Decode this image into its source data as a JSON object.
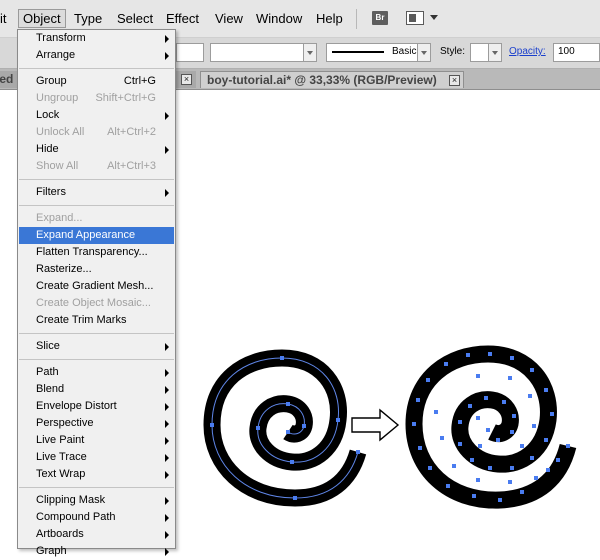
{
  "menubar": {
    "items": [
      "it",
      "Object",
      "Type",
      "Select",
      "Effect",
      "View",
      "Window",
      "Help"
    ],
    "active": "Object",
    "bridge_label": "Br"
  },
  "controlbar": {
    "stroke_style": "Basic",
    "style_label": "Style:",
    "opacity_label": "Opacity:",
    "opacity_value": "100"
  },
  "tabs": {
    "left_tab_label": "led",
    "active_tab_label": "boy-tutorial.ai* @ 33,33% (RGB/Preview)",
    "close_glyph": "×"
  },
  "menu": {
    "groups": [
      [
        {
          "label": "Transform",
          "submenu": true
        },
        {
          "label": "Arrange",
          "submenu": true
        }
      ],
      [
        {
          "label": "Group",
          "shortcut": "Ctrl+G"
        },
        {
          "label": "Ungroup",
          "shortcut": "Shift+Ctrl+G",
          "disabled": true
        },
        {
          "label": "Lock",
          "submenu": true
        },
        {
          "label": "Unlock All",
          "shortcut": "Alt+Ctrl+2",
          "disabled": true
        },
        {
          "label": "Hide",
          "submenu": true
        },
        {
          "label": "Show All",
          "shortcut": "Alt+Ctrl+3",
          "disabled": true
        }
      ],
      [
        {
          "label": "Filters",
          "submenu": true
        }
      ],
      [
        {
          "label": "Expand...",
          "disabled": true
        },
        {
          "label": "Expand Appearance",
          "highlight": true
        },
        {
          "label": "Flatten Transparency..."
        },
        {
          "label": "Rasterize..."
        },
        {
          "label": "Create Gradient Mesh..."
        },
        {
          "label": "Create Object Mosaic...",
          "disabled": true
        },
        {
          "label": "Create Trim Marks"
        }
      ],
      [
        {
          "label": "Slice",
          "submenu": true
        }
      ],
      [
        {
          "label": "Path",
          "submenu": true
        },
        {
          "label": "Blend",
          "submenu": true
        },
        {
          "label": "Envelope Distort",
          "submenu": true
        },
        {
          "label": "Perspective",
          "submenu": true
        },
        {
          "label": "Live Paint",
          "submenu": true
        },
        {
          "label": "Live Trace",
          "submenu": true
        },
        {
          "label": "Text Wrap",
          "submenu": true
        }
      ],
      [
        {
          "label": "Clipping Mask",
          "submenu": true
        },
        {
          "label": "Compound Path",
          "submenu": true
        },
        {
          "label": "Artboards",
          "submenu": true
        },
        {
          "label": "Graph",
          "submenu": true
        }
      ]
    ]
  },
  "colors": {
    "highlight": "#3a77d6",
    "anchor": "#4a7cf0",
    "path": "#5f86e8"
  },
  "icons": [
    "bridge-icon",
    "workspace-icon",
    "arrow-right-icon"
  ]
}
